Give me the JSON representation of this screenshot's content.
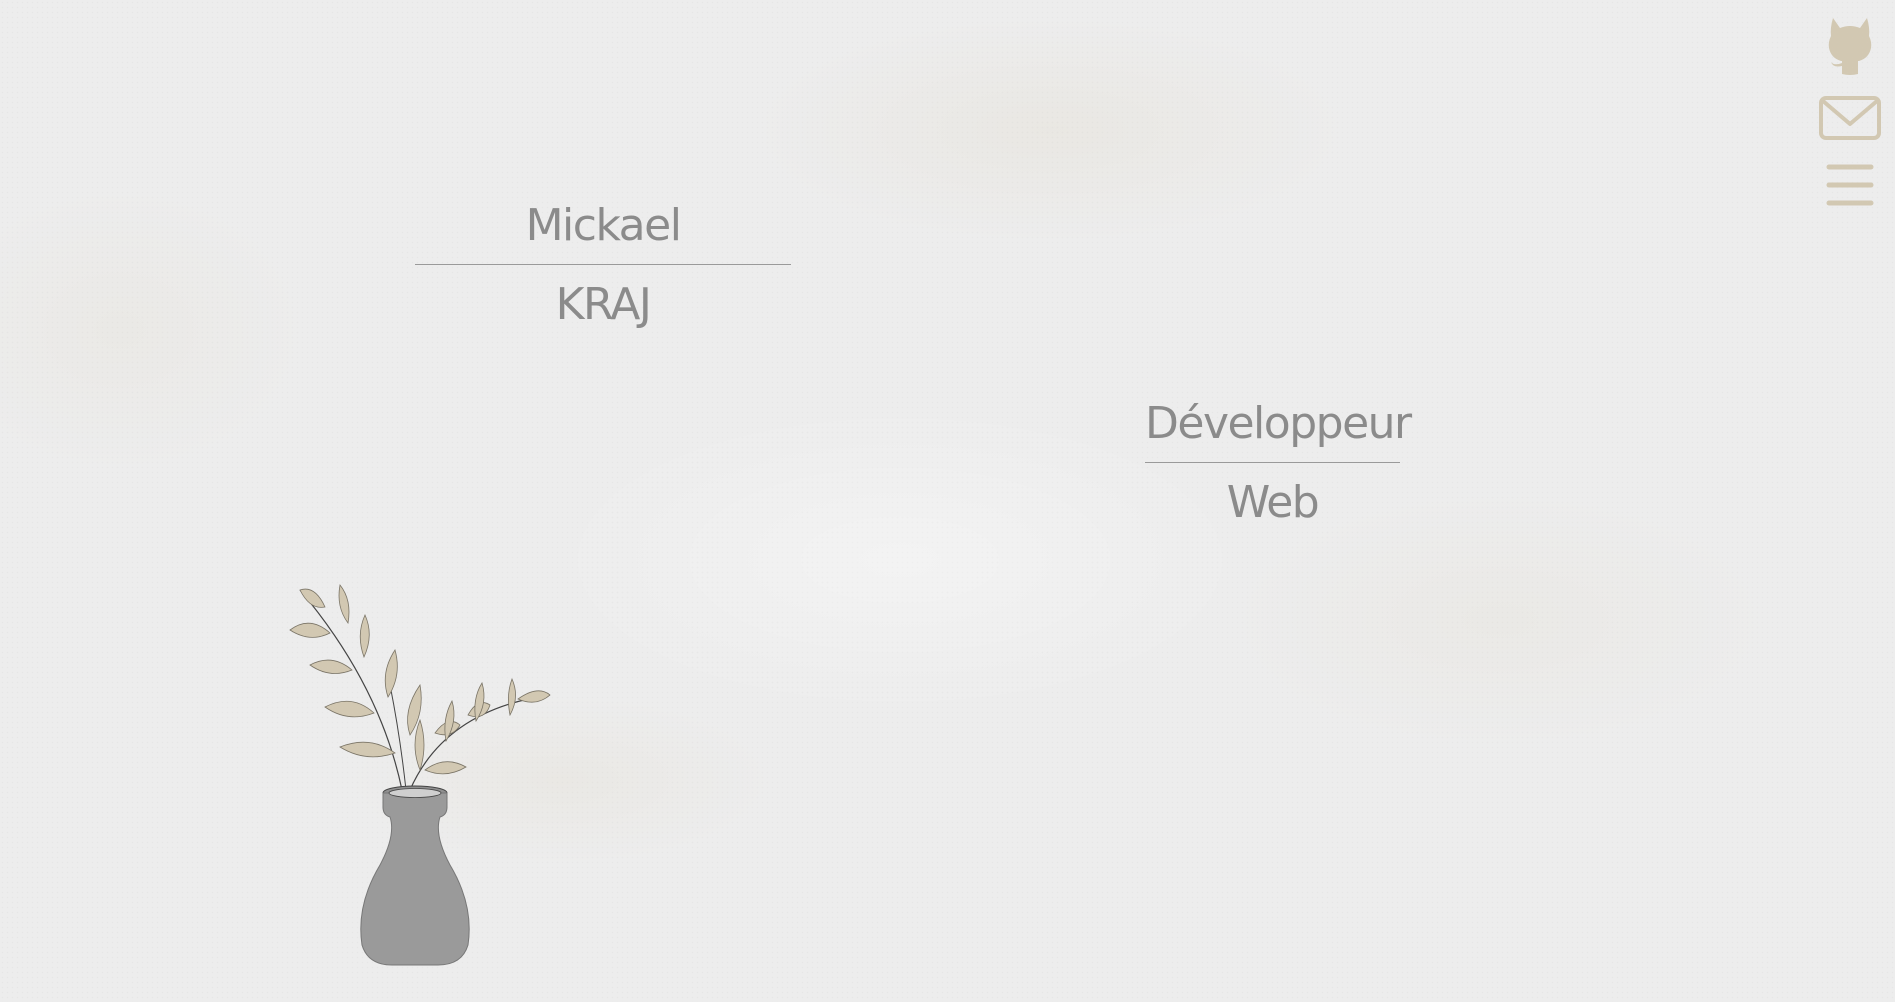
{
  "hero": {
    "first_name": "Mickael",
    "last_name": "KRAJ",
    "role_line1": "Développeur",
    "role_line2": "Web"
  },
  "nav": {
    "icons": [
      "github-icon",
      "mail-icon",
      "menu-icon"
    ]
  },
  "colors": {
    "background": "#ededed",
    "text": "#8b8b8b",
    "accent_beige": "#d2c8b2",
    "vase": "#9a9a9a"
  }
}
